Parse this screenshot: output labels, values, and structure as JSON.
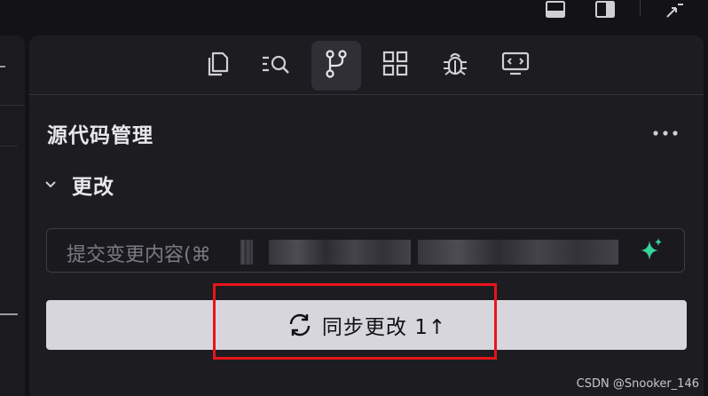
{
  "top_bar": {
    "icons": [
      "panel-bottom-icon",
      "panel-right-icon",
      "minimize-window-icon"
    ]
  },
  "tabs": [
    {
      "name": "explorer",
      "icon": "files-icon",
      "active": false
    },
    {
      "name": "search",
      "icon": "search-list-icon",
      "active": false
    },
    {
      "name": "source-control",
      "icon": "git-branch-icon",
      "active": true
    },
    {
      "name": "extensions",
      "icon": "grid-icon",
      "active": false
    },
    {
      "name": "debug",
      "icon": "bug-icon",
      "active": false
    },
    {
      "name": "remote",
      "icon": "monitor-code-icon",
      "active": false
    }
  ],
  "panel": {
    "title": "源代码管理",
    "more_label": "···"
  },
  "changes_section": {
    "label": "更改"
  },
  "commit_input": {
    "placeholder": "提交变更内容(⌘"
  },
  "sync_button": {
    "label": "同步更改 1↑"
  },
  "colors": {
    "background": "#131316",
    "panel": "#1d1d21",
    "sparkle": "#36d399",
    "button_bg": "#d6d6dc",
    "highlight": "#e8141b"
  },
  "watermark": "CSDN @Snooker_146"
}
